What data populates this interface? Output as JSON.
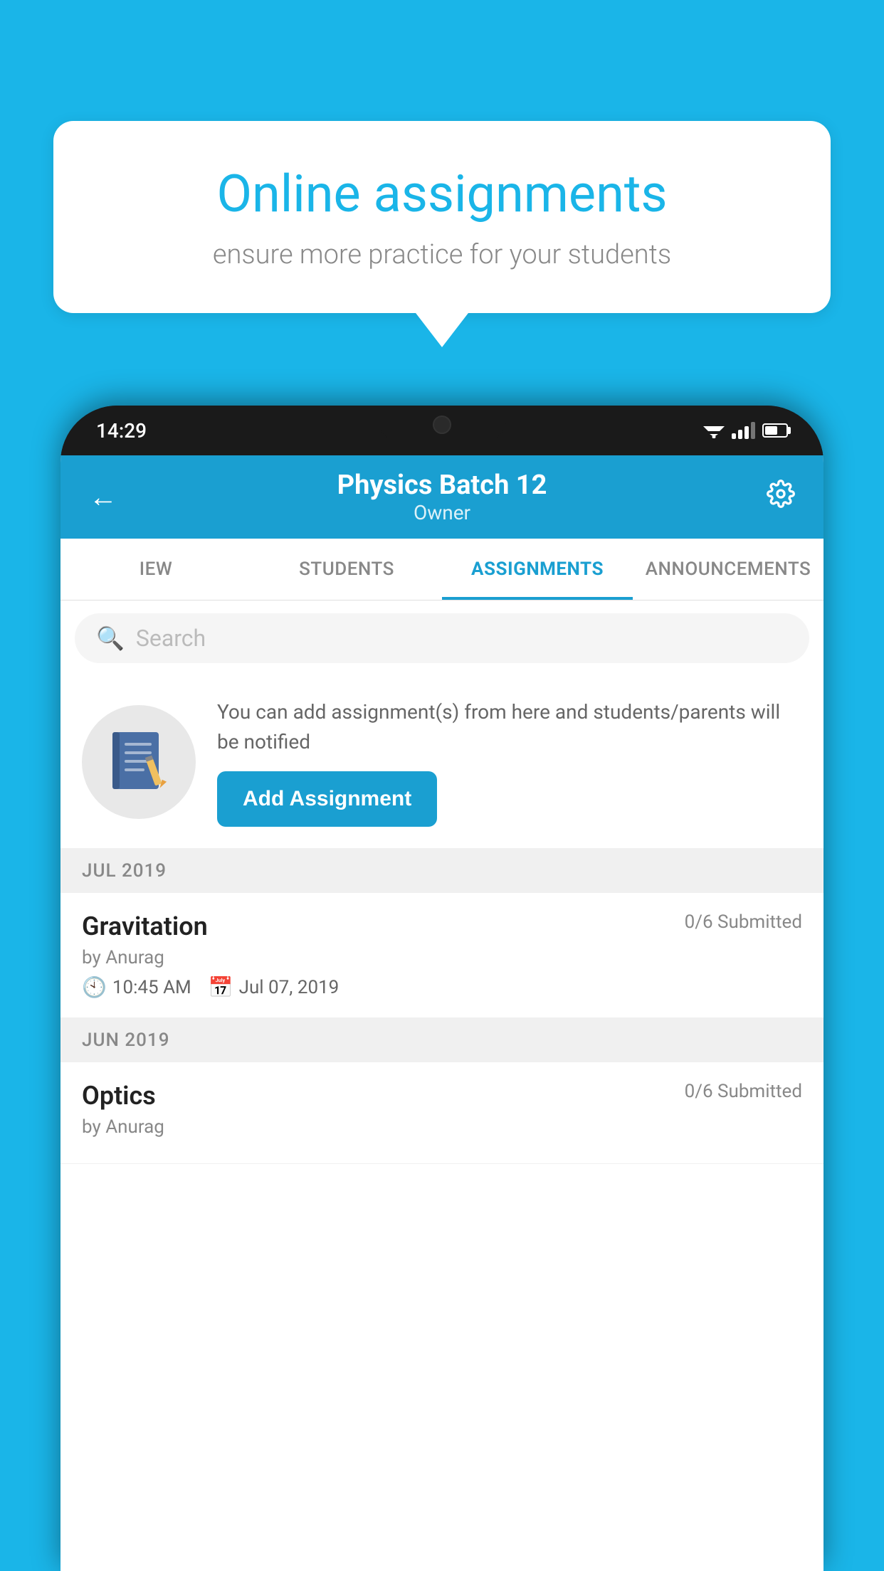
{
  "background_color": "#1ab5e8",
  "speech_bubble": {
    "title": "Online assignments",
    "subtitle": "ensure more practice for your students"
  },
  "phone": {
    "status_bar": {
      "time": "14:29"
    },
    "header": {
      "title": "Physics Batch 12",
      "subtitle": "Owner",
      "back_icon": "←",
      "settings_icon": "⚙"
    },
    "tabs": [
      {
        "label": "IEW",
        "active": false
      },
      {
        "label": "STUDENTS",
        "active": false
      },
      {
        "label": "ASSIGNMENTS",
        "active": true
      },
      {
        "label": "ANNOUNCEMENTS",
        "active": false
      }
    ],
    "search": {
      "placeholder": "Search"
    },
    "info_section": {
      "text": "You can add assignment(s) from here and students/parents will be notified",
      "button_label": "Add Assignment"
    },
    "sections": [
      {
        "month": "JUL 2019",
        "assignments": [
          {
            "name": "Gravitation",
            "submitted": "0/6 Submitted",
            "by": "by Anurag",
            "time": "10:45 AM",
            "date": "Jul 07, 2019"
          }
        ]
      },
      {
        "month": "JUN 2019",
        "assignments": [
          {
            "name": "Optics",
            "submitted": "0/6 Submitted",
            "by": "by Anurag",
            "time": "",
            "date": ""
          }
        ]
      }
    ]
  }
}
